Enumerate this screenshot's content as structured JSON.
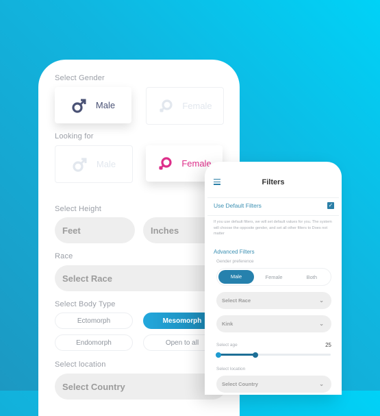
{
  "left_card": {
    "select_gender_label": "Select Gender",
    "gender_options": [
      {
        "label": "Male",
        "icon": "male-icon",
        "selected": true
      },
      {
        "label": "Female",
        "icon": "female-icon",
        "selected": false
      }
    ],
    "looking_for_label": "Looking for",
    "looking_options": [
      {
        "label": "Male",
        "icon": "male-icon",
        "selected": false
      },
      {
        "label": "Female",
        "icon": "female-icon",
        "selected": true
      }
    ],
    "height_label": "Select Height",
    "feet_placeholder": "Feet",
    "inches_placeholder": "Inches",
    "race_label": "Race",
    "race_placeholder": "Select Race",
    "body_type_label": "Select Body Type",
    "body_types": [
      {
        "label": "Ectomorph",
        "selected": false
      },
      {
        "label": "Mesomorph",
        "selected": true
      },
      {
        "label": "Endomorph",
        "selected": false
      },
      {
        "label": "Open to all",
        "selected": false
      }
    ],
    "location_label": "Select location",
    "country_placeholder": "Select Country"
  },
  "filters": {
    "title": "Filters",
    "use_default_label": "Use Default Filters",
    "use_default_checked": true,
    "note": "If you use default filters, we will set default values for you. The system will choose the opposite gender, and set all other filters to Does not matter",
    "advanced_label": "Advanced Filters",
    "gender_pref_label": "Gender preference",
    "gender_pref_options": [
      "Male",
      "Female",
      "Both"
    ],
    "gender_pref_selected": "Male",
    "race_placeholder": "Select Race",
    "kink_placeholder": "Kink",
    "age_label": "Select age",
    "age_value": "25",
    "age_range_fraction": [
      0,
      0.33
    ],
    "location_label": "Select location",
    "country_placeholder": "Select Country"
  },
  "colors": {
    "accent": "#2681ad",
    "male": "#4a5275",
    "female": "#dd2f8a",
    "bg_start": "#00d2f7",
    "bg_end": "#1c98c2"
  }
}
